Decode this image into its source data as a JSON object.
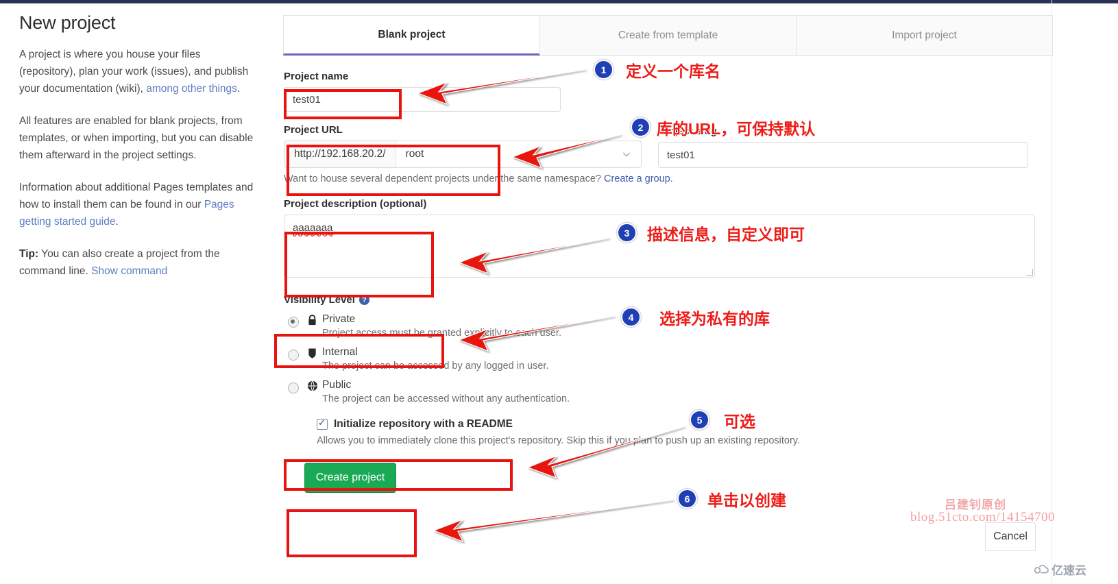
{
  "page": {
    "title": "New project",
    "paragraphs": [
      {
        "parts": [
          {
            "t": "A project is where you house your files (repository), plan your work (issues), and publish your documentation (wiki), ",
            "link": false
          },
          {
            "t": "among other things",
            "link": true
          },
          {
            "t": ".",
            "link": false
          }
        ]
      },
      {
        "parts": [
          {
            "t": "All features are enabled for blank projects, from templates, or when importing, but you can disable them afterward in the project settings.",
            "link": false
          }
        ]
      },
      {
        "parts": [
          {
            "t": "Information about additional Pages templates and how to install them can be found in our ",
            "link": false
          },
          {
            "t": "Pages getting started guide",
            "link": true
          },
          {
            "t": ".",
            "link": false
          }
        ]
      }
    ],
    "tip_label": "Tip:",
    "tip_text": " You can also create a project from the command line. ",
    "tip_link": "Show command"
  },
  "tabs": [
    {
      "label": "Blank project",
      "active": true
    },
    {
      "label": "Create from template",
      "active": false
    },
    {
      "label": "Import project",
      "active": false
    }
  ],
  "form": {
    "project_name_label": "Project name",
    "project_name_value": "test01",
    "project_url_label": "Project URL",
    "url_prefix": "http://192.168.20.2/",
    "url_namespace": "root",
    "project_slug_label": "Project slug",
    "project_slug_value": "test01",
    "namespace_hint_text": "Want to house several dependent projects under the same namespace? ",
    "namespace_hint_link": "Create a group.",
    "description_label": "Project description (optional)",
    "description_value": "aaaaaaa",
    "visibility_label": "Visibility Level",
    "visibility_help": "?",
    "visibility_options": [
      {
        "name": "Private",
        "icon": "lock-icon",
        "desc": "Project access must be granted explicitly to each user.",
        "selected": true
      },
      {
        "name": "Internal",
        "icon": "shield-icon",
        "desc": "The project can be accessed by any logged in user.",
        "selected": false
      },
      {
        "name": "Public",
        "icon": "globe-icon",
        "desc": "The project can be accessed without any authentication.",
        "selected": false
      }
    ],
    "readme_label": "Initialize repository with a README",
    "readme_checked": true,
    "readme_hint": "Allows you to immediately clone this project's repository. Skip this if you plan to push up an existing repository.",
    "create_button": "Create project",
    "cancel_button": "Cancel"
  },
  "annotations": [
    {
      "num": "1",
      "text": "定义一个库名"
    },
    {
      "num": "2",
      "text": "库的URL，可保持默认"
    },
    {
      "num": "3",
      "text": "描述信息，自定义即可"
    },
    {
      "num": "4",
      "text": "选择为私有的库"
    },
    {
      "num": "5",
      "text": "可选"
    },
    {
      "num": "6",
      "text": "单击以创建"
    }
  ],
  "watermarks": {
    "line1": "吕建钊原创",
    "line2": "blog.51cto.com/14154700",
    "corner": "亿速云"
  },
  "colors": {
    "accent_red": "#ee1c18",
    "badge_blue": "#1f3fb5",
    "create_green": "#1aaa55",
    "tab_underline": "#6b63c4",
    "link_blue": "#3b5fa8"
  }
}
